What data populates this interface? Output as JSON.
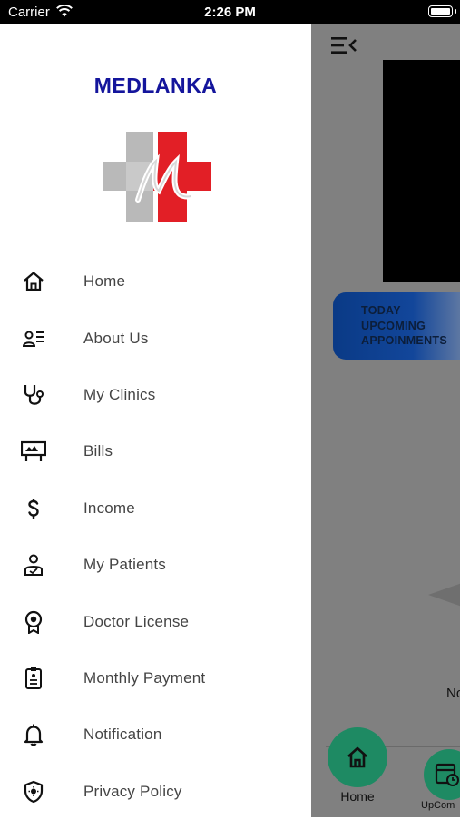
{
  "status_bar": {
    "carrier": "Carrier",
    "time": "2:26 PM"
  },
  "drawer": {
    "brand": "MEDLANKA",
    "items": [
      {
        "label": "Home",
        "icon": "home-icon"
      },
      {
        "label": "About Us",
        "icon": "user-list-icon"
      },
      {
        "label": "My Clinics",
        "icon": "stethoscope-icon"
      },
      {
        "label": "Bills",
        "icon": "bill-board-icon"
      },
      {
        "label": "Income",
        "icon": "dollar-icon"
      },
      {
        "label": "My Patients",
        "icon": "patient-icon"
      },
      {
        "label": "Doctor License",
        "icon": "award-badge-icon"
      },
      {
        "label": "Monthly Payment",
        "icon": "clipboard-icon"
      },
      {
        "label": "Notification",
        "icon": "bell-icon"
      },
      {
        "label": "Privacy Policy",
        "icon": "shield-icon"
      }
    ]
  },
  "main": {
    "appointments_card": "TODAY\nUPCOMING\nAPPOINMENTS",
    "no_text": "No",
    "bottom_nav": {
      "home_label": "Home",
      "upcoming_label": "UpCom"
    }
  },
  "colors": {
    "brand": "#14159c",
    "accent_green": "#1e8a63",
    "logo_red": "#e21f26"
  }
}
